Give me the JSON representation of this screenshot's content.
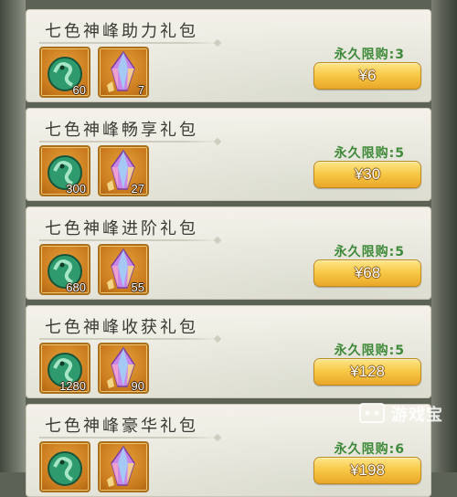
{
  "packs": [
    {
      "title": "七色神峰助力礼包",
      "jade_qty": "60",
      "crystal_qty": "7",
      "limit": "永久限购:3",
      "price": "¥6"
    },
    {
      "title": "七色神峰畅享礼包",
      "jade_qty": "300",
      "crystal_qty": "27",
      "limit": "永久限购:5",
      "price": "¥30"
    },
    {
      "title": "七色神峰进阶礼包",
      "jade_qty": "680",
      "crystal_qty": "55",
      "limit": "永久限购:5",
      "price": "¥68"
    },
    {
      "title": "七色神峰收获礼包",
      "jade_qty": "1280",
      "crystal_qty": "90",
      "limit": "永久限购:5",
      "price": "¥128"
    },
    {
      "title": "七色神峰豪华礼包",
      "jade_qty": "",
      "crystal_qty": "",
      "limit": "永久限购:6",
      "price": "¥198"
    }
  ],
  "icons": {
    "item1": "jade-dragon-icon",
    "item2": "rainbow-crystal-icon"
  },
  "watermark": {
    "text": "游戏宝"
  },
  "colors": {
    "limit_text": "#3f8a3a",
    "buy_button": "#f7c845",
    "item_frame": "#c97a1d"
  }
}
